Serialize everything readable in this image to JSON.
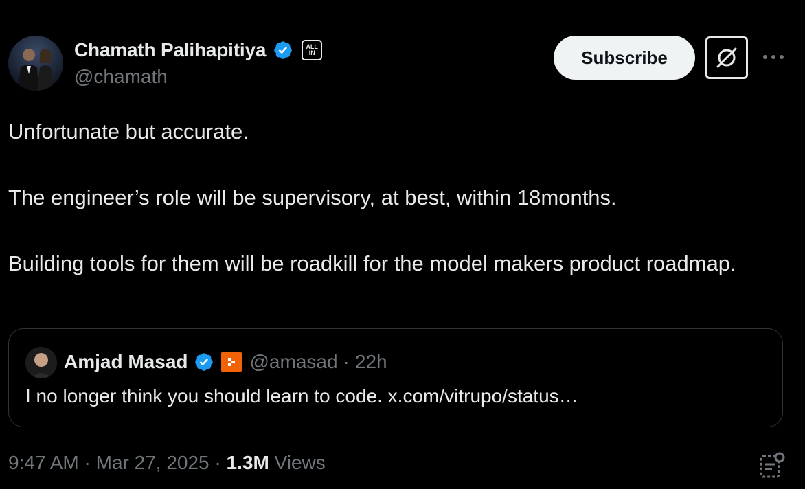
{
  "author": {
    "display_name": "Chamath Palihapitiya",
    "handle": "@chamath",
    "verified_icon": "verified-badge-icon",
    "affiliate_badge_text_line1": "ALL",
    "affiliate_badge_text_line2": "IN"
  },
  "actions": {
    "subscribe_label": "Subscribe",
    "grok_icon": "grok-icon",
    "more_icon": "more-icon"
  },
  "tweet": {
    "paragraph_1": "Unfortunate but accurate.",
    "paragraph_2": "The engineer’s role will be supervisory, at best, within 18months.",
    "paragraph_3": "Building tools for them will be roadkill for the model makers product roadmap."
  },
  "quoted_tweet": {
    "display_name": "Amjad Masad",
    "handle": "@amasad",
    "separator": "·",
    "time": "22h",
    "text": "I no longer think you should learn to code. x.com/vitrupo/status…",
    "affiliate_icon": "replit-icon"
  },
  "meta": {
    "time": "9:47 AM",
    "date": "Mar 27, 2025",
    "separator": "·",
    "views_count": "1.3M",
    "views_label": "Views"
  },
  "colors": {
    "background": "#000000",
    "primary_text": "#e7e9ea",
    "secondary_text": "#71767b",
    "verified_blue": "#1d9bf0",
    "replit_orange": "#f26207",
    "border": "#2f3336"
  }
}
